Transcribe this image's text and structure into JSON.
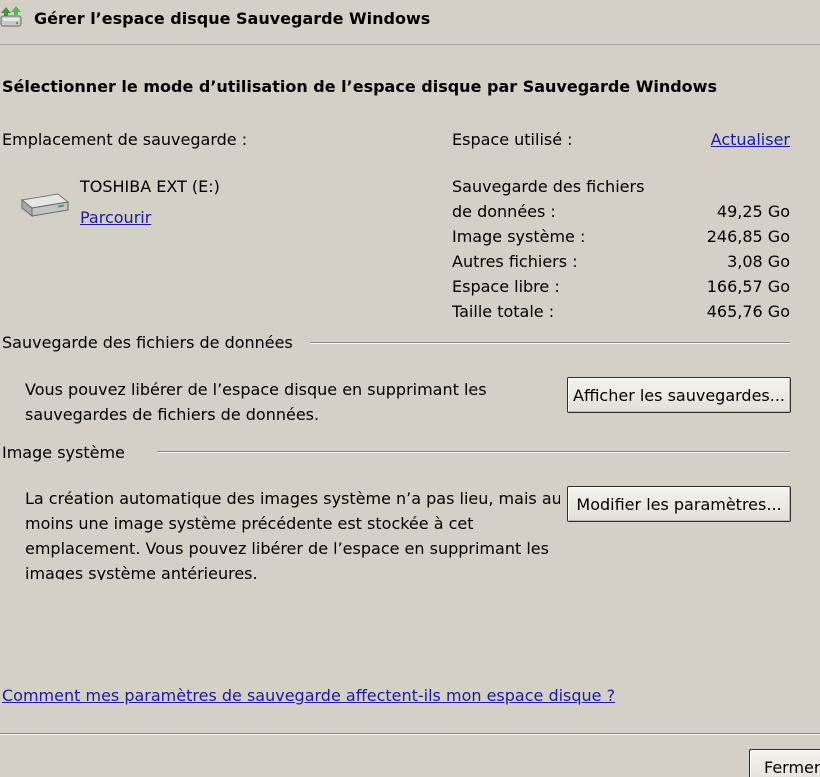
{
  "window": {
    "title": "Gérer l’espace disque Sauvegarde Windows",
    "icon": "backup-disk-icon"
  },
  "heading": "Sélectionner le mode d’utilisation de l’espace disque par Sauvegarde Windows",
  "location": {
    "label": "Emplacement de sauvegarde :",
    "drive_name": "TOSHIBA EXT (E:)",
    "browse_link": "Parcourir",
    "drive_icon": "external-drive-icon"
  },
  "usage": {
    "label": "Espace utilisé :",
    "refresh_link": "Actualiser",
    "rows": [
      {
        "label_line1": "Sauvegarde des fichiers",
        "label_line2": "de données :",
        "value": "49,25 Go"
      },
      {
        "label": "Image système :",
        "value": "246,85 Go"
      },
      {
        "label": "Autres fichiers :",
        "value": "3,08 Go"
      },
      {
        "label": "Espace libre :",
        "value": "166,57 Go"
      },
      {
        "label": "Taille totale :",
        "value": "465,76 Go"
      }
    ]
  },
  "data_backup_section": {
    "title": "Sauvegarde des fichiers de données",
    "description_lines": [
      "Vous pouvez libérer de l’espace disque en supprimant les",
      "sauvegardes de fichiers de données."
    ],
    "button_label": "Afficher les sauvegardes..."
  },
  "system_image_section": {
    "title": "Image système",
    "description_lines": [
      "La création automatique des images système n’a pas lieu, mais au",
      "moins une image système précédente est stockée à cet",
      "emplacement. Vous pouvez libérer de l’espace en supprimant les",
      "images système antérieures."
    ],
    "button_label": "Modifier les paramètres..."
  },
  "help_link": "Comment mes paramètres de sauvegarde affectent-ils mon espace disque ?",
  "close_button": "Fermer"
}
